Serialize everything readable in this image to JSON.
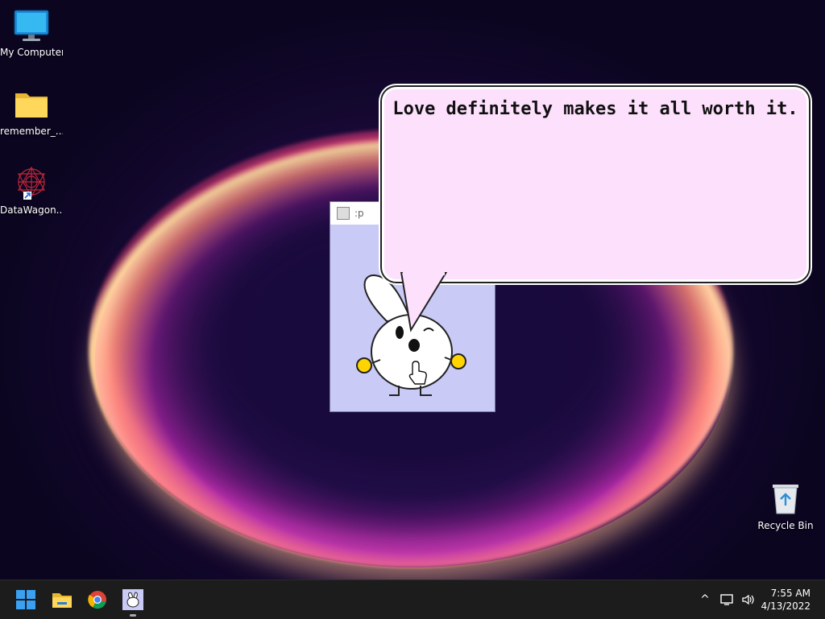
{
  "desktop": {
    "icons": [
      {
        "label": "My Computer"
      },
      {
        "label": "remember_..."
      },
      {
        "label": "DataWagon..."
      },
      {
        "label": "Recycle Bin"
      }
    ]
  },
  "app_window": {
    "title": ":p"
  },
  "speech_bubble": {
    "text": "Love definitely makes it all worth it."
  },
  "taskbar": {
    "clock_time": "7:55 AM",
    "clock_date": "4/13/2022",
    "pinned": [
      "start-icon",
      "file-explorer-icon",
      "chrome-icon",
      "bunny-app-icon"
    ]
  },
  "colors": {
    "bubble_fill": "#fde0fc",
    "app_background": "#c9caf5",
    "taskbar": "#1c1c1c"
  }
}
